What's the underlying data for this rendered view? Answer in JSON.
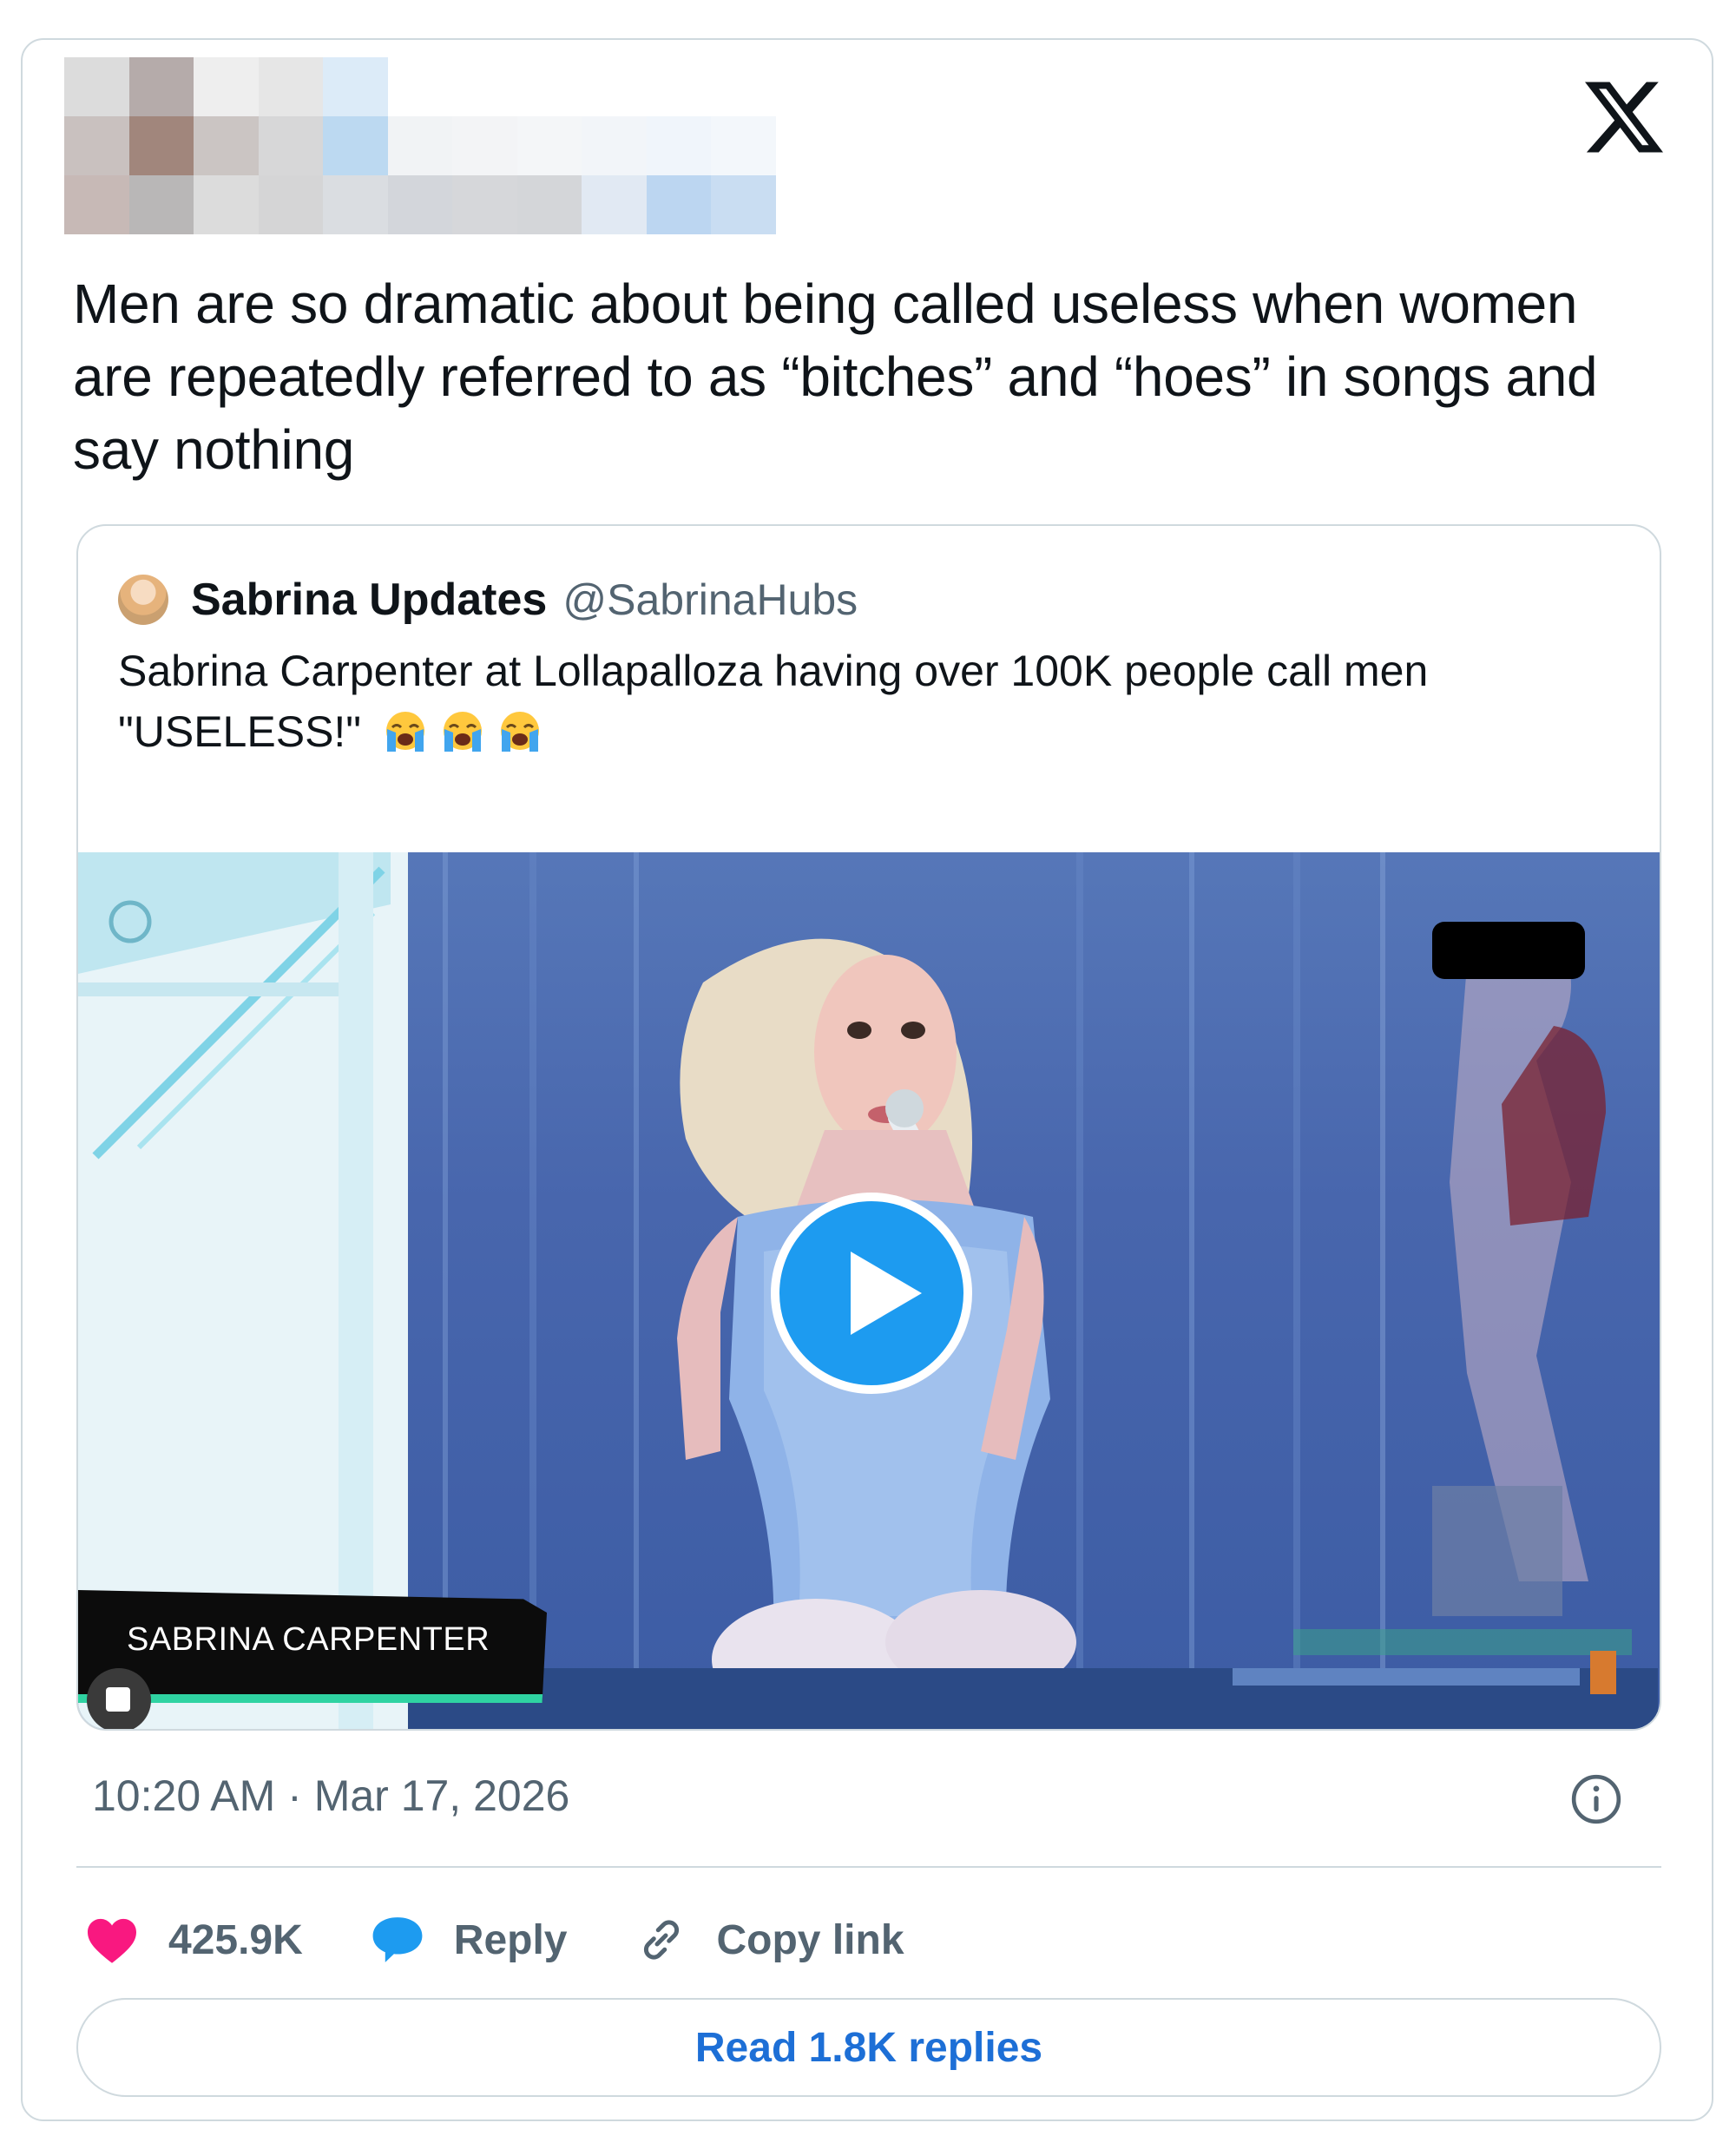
{
  "tweet": {
    "text": "Men are so dramatic about being called useless when women are repeatedly referred to as “bitches” and “hoes” in songs and say nothing",
    "timestamp": "10:20 AM · Mar 17, 2026",
    "brand_icon": "x-logo-icon"
  },
  "quote": {
    "author_name": "Sabrina Updates",
    "author_handle": "@SabrinaHubs",
    "text": "Sabrina Carpenter at Lollapalloza having over 100K people call men \"USELESS!\"",
    "emojis": [
      "loudly-crying-face-icon",
      "loudly-crying-face-icon",
      "loudly-crying-face-icon"
    ],
    "video": {
      "lower_third": "SABRINA CARPENTER",
      "play_icon": "play-icon"
    }
  },
  "actions": {
    "likes": "425.9K",
    "reply_label": "Reply",
    "copy_label": "Copy link"
  },
  "read_replies_label": "Read 1.8K replies",
  "colors": {
    "accent": "#1d9bf0",
    "like": "#f91880",
    "link": "#1d6fd6",
    "muted": "#536471",
    "border": "#cfd9de"
  }
}
